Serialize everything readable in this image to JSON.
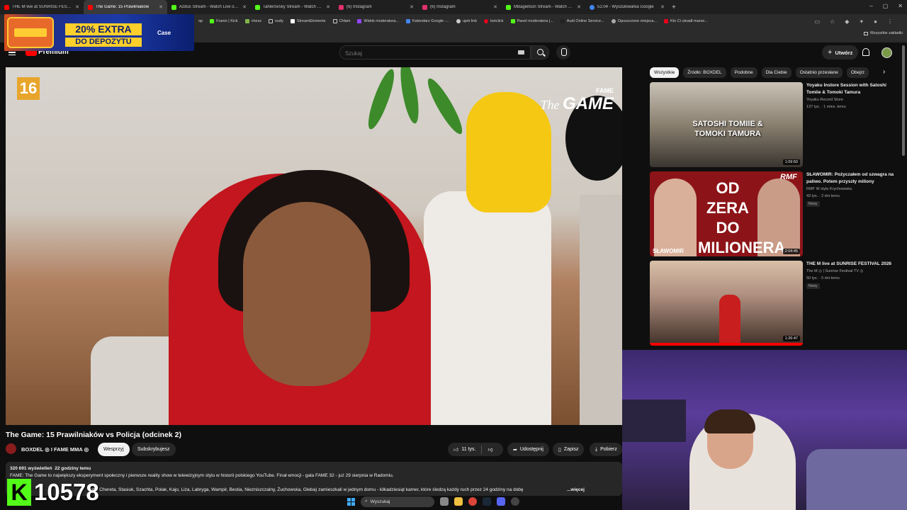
{
  "browser": {
    "tabs": [
      {
        "label": "THE M live at SUNRISE FESTIVAL",
        "color": "#ff0000",
        "active": false
      },
      {
        "label": "The Game: 15 Prawilniaków",
        "color": "#ff0000",
        "active": true
      },
      {
        "label": "Azdus Stream - Watch Live on Kick",
        "color": "#53fc18",
        "active": false
      },
      {
        "label": "Tahlerovsky Stream - Watch Live",
        "color": "#53fc18",
        "active": false
      },
      {
        "label": "(6) Instagram",
        "color": "#e1306c",
        "active": false
      },
      {
        "label": "(6) Instagram",
        "color": "#e1306c",
        "active": false
      },
      {
        "label": "MBagietson Stream - Watch Live",
        "color": "#53fc18",
        "active": false
      },
      {
        "label": "51:04 - Wyszukiwarka Google",
        "color": "#4285f4",
        "active": false
      }
    ],
    "bookmarks": [
      {
        "label": "op",
        "color": "#888888"
      },
      {
        "label": "Franio | Kick",
        "color": "#53fc18"
      },
      {
        "label": "chess",
        "color": "#81b64c"
      },
      {
        "label": "nudy",
        "color": "#cccccc"
      },
      {
        "label": "StreamElements",
        "color": "#ffffff"
      },
      {
        "label": "Chłam",
        "color": "#cccccc"
      },
      {
        "label": "Widok moderatora...",
        "color": "#9146ff"
      },
      {
        "label": "Kalendarz Google -...",
        "color": "#4285f4"
      },
      {
        "label": "ujeb link",
        "color": "#cccccc"
      },
      {
        "label": "betclick",
        "color": "#e2001a"
      },
      {
        "label": "Panel moderatora |...",
        "color": "#53fc18"
      },
      {
        "label": "Audi Online Service...",
        "color": "#222222"
      },
      {
        "label": "Opuszczone miejsca...",
        "color": "#333333"
      },
      {
        "label": "Kto Ci ukradł marze...",
        "color": "#e2001a"
      }
    ],
    "all_bookmarks": "Wszystkie zakładki"
  },
  "ad": {
    "line1": "20% EXTRA",
    "line2": "DO DEPOZYTU",
    "brand": "Case"
  },
  "youtube": {
    "logo_text": "Premium",
    "search_placeholder": "Szukaj",
    "create_label": "Utwórz"
  },
  "video": {
    "rating": "16",
    "logo_fame": "FAME",
    "logo_the": "The",
    "logo_game": "GAME",
    "title": "The Game: 15 Prawilniaków vs Policja (odcinek 2)",
    "channel": "BOXDEL ◎ I FAME MMA ◎",
    "support_label": "Wesprzyj",
    "subscribed_label": "Subskrybujesz",
    "likes": "11 tys.",
    "share_label": "Udostępnij",
    "save_label": "Zapisz",
    "download_label": "Pobierz",
    "views": "320 691 wyświetleń",
    "age": "22 godziny temu",
    "desc_line1": "FAME: The Game to największy eksperyment społeczny i pierwsze reality show w telewizyjnym stylu w historii polskiego YouTube. Finał emocji - gala FAME 32 - już 29 sierpnia w Radomiu.",
    "desc_line2": "ento, Chereta, Stasiuk, Szachta, Polak, Kajo, Liza, Labryga, Wampir, Bestia, Niezniszczalny, Żuchowska, Gleba) zamieszkali w jednym domu - kilkadziesiąt kamer, które śledzą każdy ruch przez 24 godziny na dobę",
    "more_label": "...więcej"
  },
  "chips": [
    "Wszystkie",
    "Źródło: BOXDEL",
    "Podobne",
    "Dla Ciebie",
    "Ostatnio przesłane",
    "Obejrz"
  ],
  "recommendations": [
    {
      "title": "Yoyaku Instore Session with Satoshi Tomiie & Tomoki Tamura",
      "channel": "Yoyaku Record Store",
      "meta": "137 tys. · 1 mies. temu",
      "duration": "1:09:50",
      "overlay": "SATOSHI TOMIIE & TOMOKI TAMURA",
      "badge": ""
    },
    {
      "title": "SŁAWOMIR: Pożyczałem od szwagra na paliwo. Potem przyszły miliony",
      "channel": "RMF W stylu Krychowiaka",
      "meta": "43 tys. · 2 dni temu",
      "duration": "2:04:45",
      "overlay": "OD ZERA DO MILIONERA",
      "overlay_name": "SŁAWOMIR",
      "overlay_brand": "RMF",
      "badge": "Nowy"
    },
    {
      "title": "THE M live at SUNRISE FESTIVAL 2026",
      "channel": "The M ◎ | Sunrise Festival TV ◎",
      "meta": "50 tys. · 5 dni temu",
      "duration": "1:26:47",
      "overlay": "",
      "badge": "Nowy"
    }
  ],
  "kick": {
    "logo": "K",
    "count": "10578"
  },
  "taskbar": {
    "search_label": "Wyszukaj"
  }
}
